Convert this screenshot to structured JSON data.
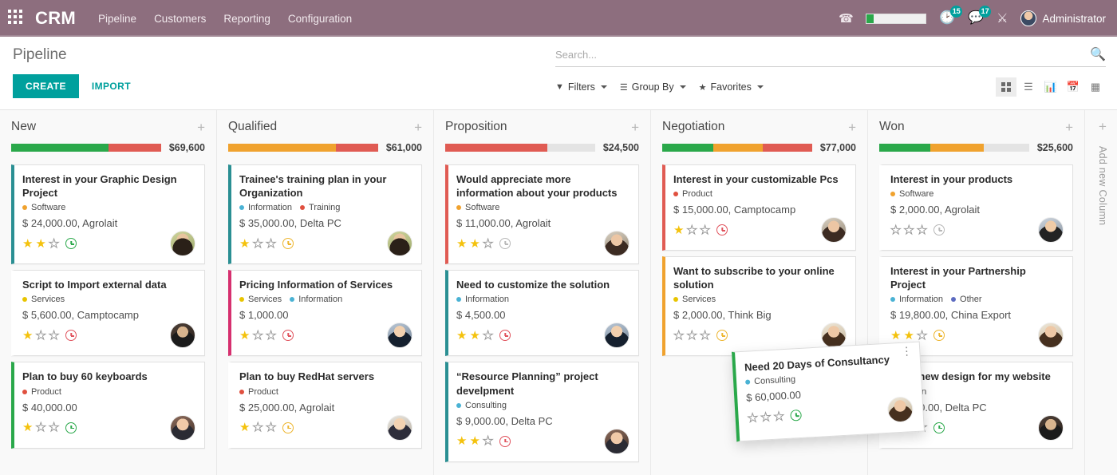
{
  "navbar": {
    "apps_icon": "apps-grid-icon",
    "brand": "CRM",
    "menu": [
      {
        "label": "Pipeline"
      },
      {
        "label": "Customers"
      },
      {
        "label": "Reporting"
      },
      {
        "label": "Configuration"
      }
    ],
    "phone_icon": "phone-icon",
    "activity_icon": "clock-icon",
    "activity_count": "15",
    "messages_icon": "chat-bubble-icon",
    "messages_count": "17",
    "tools_icon": "tools-icon",
    "user_name": "Administrator",
    "brand_color": "#8d6e7e",
    "badge_color": "#00a09d"
  },
  "control_panel": {
    "page_title": "Pipeline",
    "create_label": "CREATE",
    "import_label": "IMPORT",
    "search_placeholder": "Search...",
    "search_value": "",
    "filters_label": "Filters",
    "group_by_label": "Group By",
    "favorites_label": "Favorites",
    "views": [
      {
        "name": "kanban",
        "icon": "kanban-view-icon",
        "active": true
      },
      {
        "name": "list",
        "icon": "list-view-icon",
        "active": false
      },
      {
        "name": "graph",
        "icon": "bar-chart-view-icon",
        "active": false
      },
      {
        "name": "calendar",
        "icon": "calendar-view-icon",
        "active": false
      },
      {
        "name": "pivot",
        "icon": "pivot-table-view-icon",
        "active": false
      }
    ],
    "accent_color": "#00a09d"
  },
  "kanban": {
    "add_column_label": "Add new Column",
    "columns": [
      {
        "title": "New",
        "total": "$69,600",
        "meter": [
          {
            "color": "#2aa84a",
            "pct": 65
          },
          {
            "color": "#e05b53",
            "pct": 35
          },
          {
            "color": "#e4e4e4",
            "pct": 0
          }
        ],
        "cards": [
          {
            "title": "Interest in your Graphic Design Project",
            "tags": [
              {
                "label": "Software",
                "color": "#f0a22e"
              }
            ],
            "amount": "$ 24,000.00, Agrolait",
            "stars_filled": 2,
            "stars_total": 3,
            "clock_color": "#2aa84a",
            "border_color": "#2a8f93",
            "avatar": "av1"
          },
          {
            "title": "Script to Import external data",
            "tags": [
              {
                "label": "Services",
                "color": "#e8c400"
              }
            ],
            "amount": "$ 5,600.00, Camptocamp",
            "stars_filled": 1,
            "stars_total": 3,
            "clock_color": "#e0525c",
            "border_color": "#ffffff",
            "avatar": "av2"
          },
          {
            "title": "Plan to buy 60 keyboards",
            "tags": [
              {
                "label": "Product",
                "color": "#e0503f"
              }
            ],
            "amount": "$ 40,000.00",
            "stars_filled": 1,
            "stars_total": 3,
            "clock_color": "#2aa84a",
            "border_color": "#2aa84a",
            "avatar": "av3"
          }
        ]
      },
      {
        "title": "Qualified",
        "total": "$61,000",
        "meter": [
          {
            "color": "#f0a22e",
            "pct": 72
          },
          {
            "color": "#e05b53",
            "pct": 28
          },
          {
            "color": "#e4e4e4",
            "pct": 0
          }
        ],
        "cards": [
          {
            "title": "Trainee's training plan in your Organization",
            "tags": [
              {
                "label": "Information",
                "color": "#4ab2d4"
              },
              {
                "label": "Training",
                "color": "#e0503f"
              }
            ],
            "amount": "$ 35,000.00, Delta PC",
            "stars_filled": 1,
            "stars_total": 3,
            "clock_color": "#edb52e",
            "border_color": "#2a8f93",
            "avatar": "av1"
          },
          {
            "title": "Pricing Information of Services",
            "tags": [
              {
                "label": "Services",
                "color": "#e8c400"
              },
              {
                "label": "Information",
                "color": "#4ab2d4"
              }
            ],
            "amount": "$ 1,000.00",
            "stars_filled": 1,
            "stars_total": 3,
            "clock_color": "#e0525c",
            "border_color": "#d6306f",
            "avatar": "av4"
          },
          {
            "title": "Plan to buy RedHat servers",
            "tags": [
              {
                "label": "Product",
                "color": "#e0503f"
              }
            ],
            "amount": "$ 25,000.00, Agrolait",
            "stars_filled": 1,
            "stars_total": 3,
            "clock_color": "#edb52e",
            "border_color": "#ffffff",
            "avatar": "av5"
          }
        ]
      },
      {
        "title": "Proposition",
        "total": "$24,500",
        "meter": [
          {
            "color": "#e05b53",
            "pct": 68
          },
          {
            "color": "#e4e4e4",
            "pct": 32
          }
        ],
        "cards": [
          {
            "title": "Would appreciate more information about your products",
            "tags": [
              {
                "label": "Software",
                "color": "#f0a22e"
              }
            ],
            "amount": "$ 11,000.00, Agrolait",
            "stars_filled": 2,
            "stars_total": 3,
            "clock_color": "#b8b8b8",
            "border_color": "#e05b53",
            "avatar": "av6"
          },
          {
            "title": "Need to customize the solution",
            "tags": [
              {
                "label": "Information",
                "color": "#4ab2d4"
              }
            ],
            "amount": "$ 4,500.00",
            "stars_filled": 2,
            "stars_total": 3,
            "clock_color": "#e0525c",
            "border_color": "#2a8f93",
            "avatar": "av4"
          },
          {
            "title": "“Resource Planning” project develpment",
            "tags": [
              {
                "label": "Consulting",
                "color": "#4ab2d4"
              }
            ],
            "amount": "$ 9,000.00, Delta PC",
            "stars_filled": 2,
            "stars_total": 3,
            "clock_color": "#e0525c",
            "border_color": "#2a8f93",
            "avatar": "av3"
          }
        ]
      },
      {
        "title": "Negotiation",
        "total": "$77,000",
        "meter": [
          {
            "color": "#2aa84a",
            "pct": 34
          },
          {
            "color": "#f0a22e",
            "pct": 33
          },
          {
            "color": "#e05b53",
            "pct": 33
          }
        ],
        "cards": [
          {
            "title": "Interest in your customizable Pcs",
            "tags": [
              {
                "label": "Product",
                "color": "#e0503f"
              }
            ],
            "amount": "$ 15,000.00, Camptocamp",
            "stars_filled": 1,
            "stars_total": 3,
            "clock_color": "#e0525c",
            "border_color": "#e05b53",
            "avatar": "av6"
          },
          {
            "title": "Want to subscribe to your online solution",
            "tags": [
              {
                "label": "Services",
                "color": "#e8c400"
              }
            ],
            "amount": "$ 2,000.00, Think Big",
            "stars_filled": 0,
            "stars_total": 3,
            "clock_color": "#edb52e",
            "border_color": "#f0a22e",
            "avatar": "av8"
          }
        ]
      },
      {
        "title": "Won",
        "total": "$25,600",
        "meter": [
          {
            "color": "#2aa84a",
            "pct": 34
          },
          {
            "color": "#f0a22e",
            "pct": 36
          },
          {
            "color": "#e4e4e4",
            "pct": 30
          }
        ],
        "cards": [
          {
            "title": "Interest in your products",
            "tags": [
              {
                "label": "Software",
                "color": "#f0a22e"
              }
            ],
            "amount": "$ 2,000.00, Agrolait",
            "stars_filled": 0,
            "stars_total": 3,
            "clock_color": "#b8b8b8",
            "border_color": "#ffffff",
            "avatar": "av7"
          },
          {
            "title": "Interest in your Partnership Project",
            "tags": [
              {
                "label": "Information",
                "color": "#4ab2d4"
              },
              {
                "label": "Other",
                "color": "#5c6bc0"
              }
            ],
            "amount": "$ 19,800.00, China Export",
            "stars_filled": 2,
            "stars_total": 3,
            "clock_color": "#edb52e",
            "border_color": "#ffffff",
            "avatar": "av8"
          },
          {
            "title": "Need new design for my website",
            "tags": [
              {
                "label": "Design",
                "color": "#9b3d6e"
              }
            ],
            "amount": "$ 3,800.00, Delta PC",
            "stars_filled": 2,
            "stars_total": 3,
            "clock_color": "#2aa84a",
            "border_color": "#ffffff",
            "avatar": "av2"
          }
        ]
      }
    ],
    "dragged_card": {
      "title": "Need 20 Days of Consultancy",
      "tags": [
        {
          "label": "Consulting",
          "color": "#4ab2d4"
        }
      ],
      "amount": "$ 60,000.00",
      "stars_filled": 0,
      "stars_total": 3,
      "clock_color": "#2aa84a",
      "border_color": "#2aa84a",
      "avatar": "av8",
      "menu_icon": "kebab-menu-icon"
    }
  }
}
